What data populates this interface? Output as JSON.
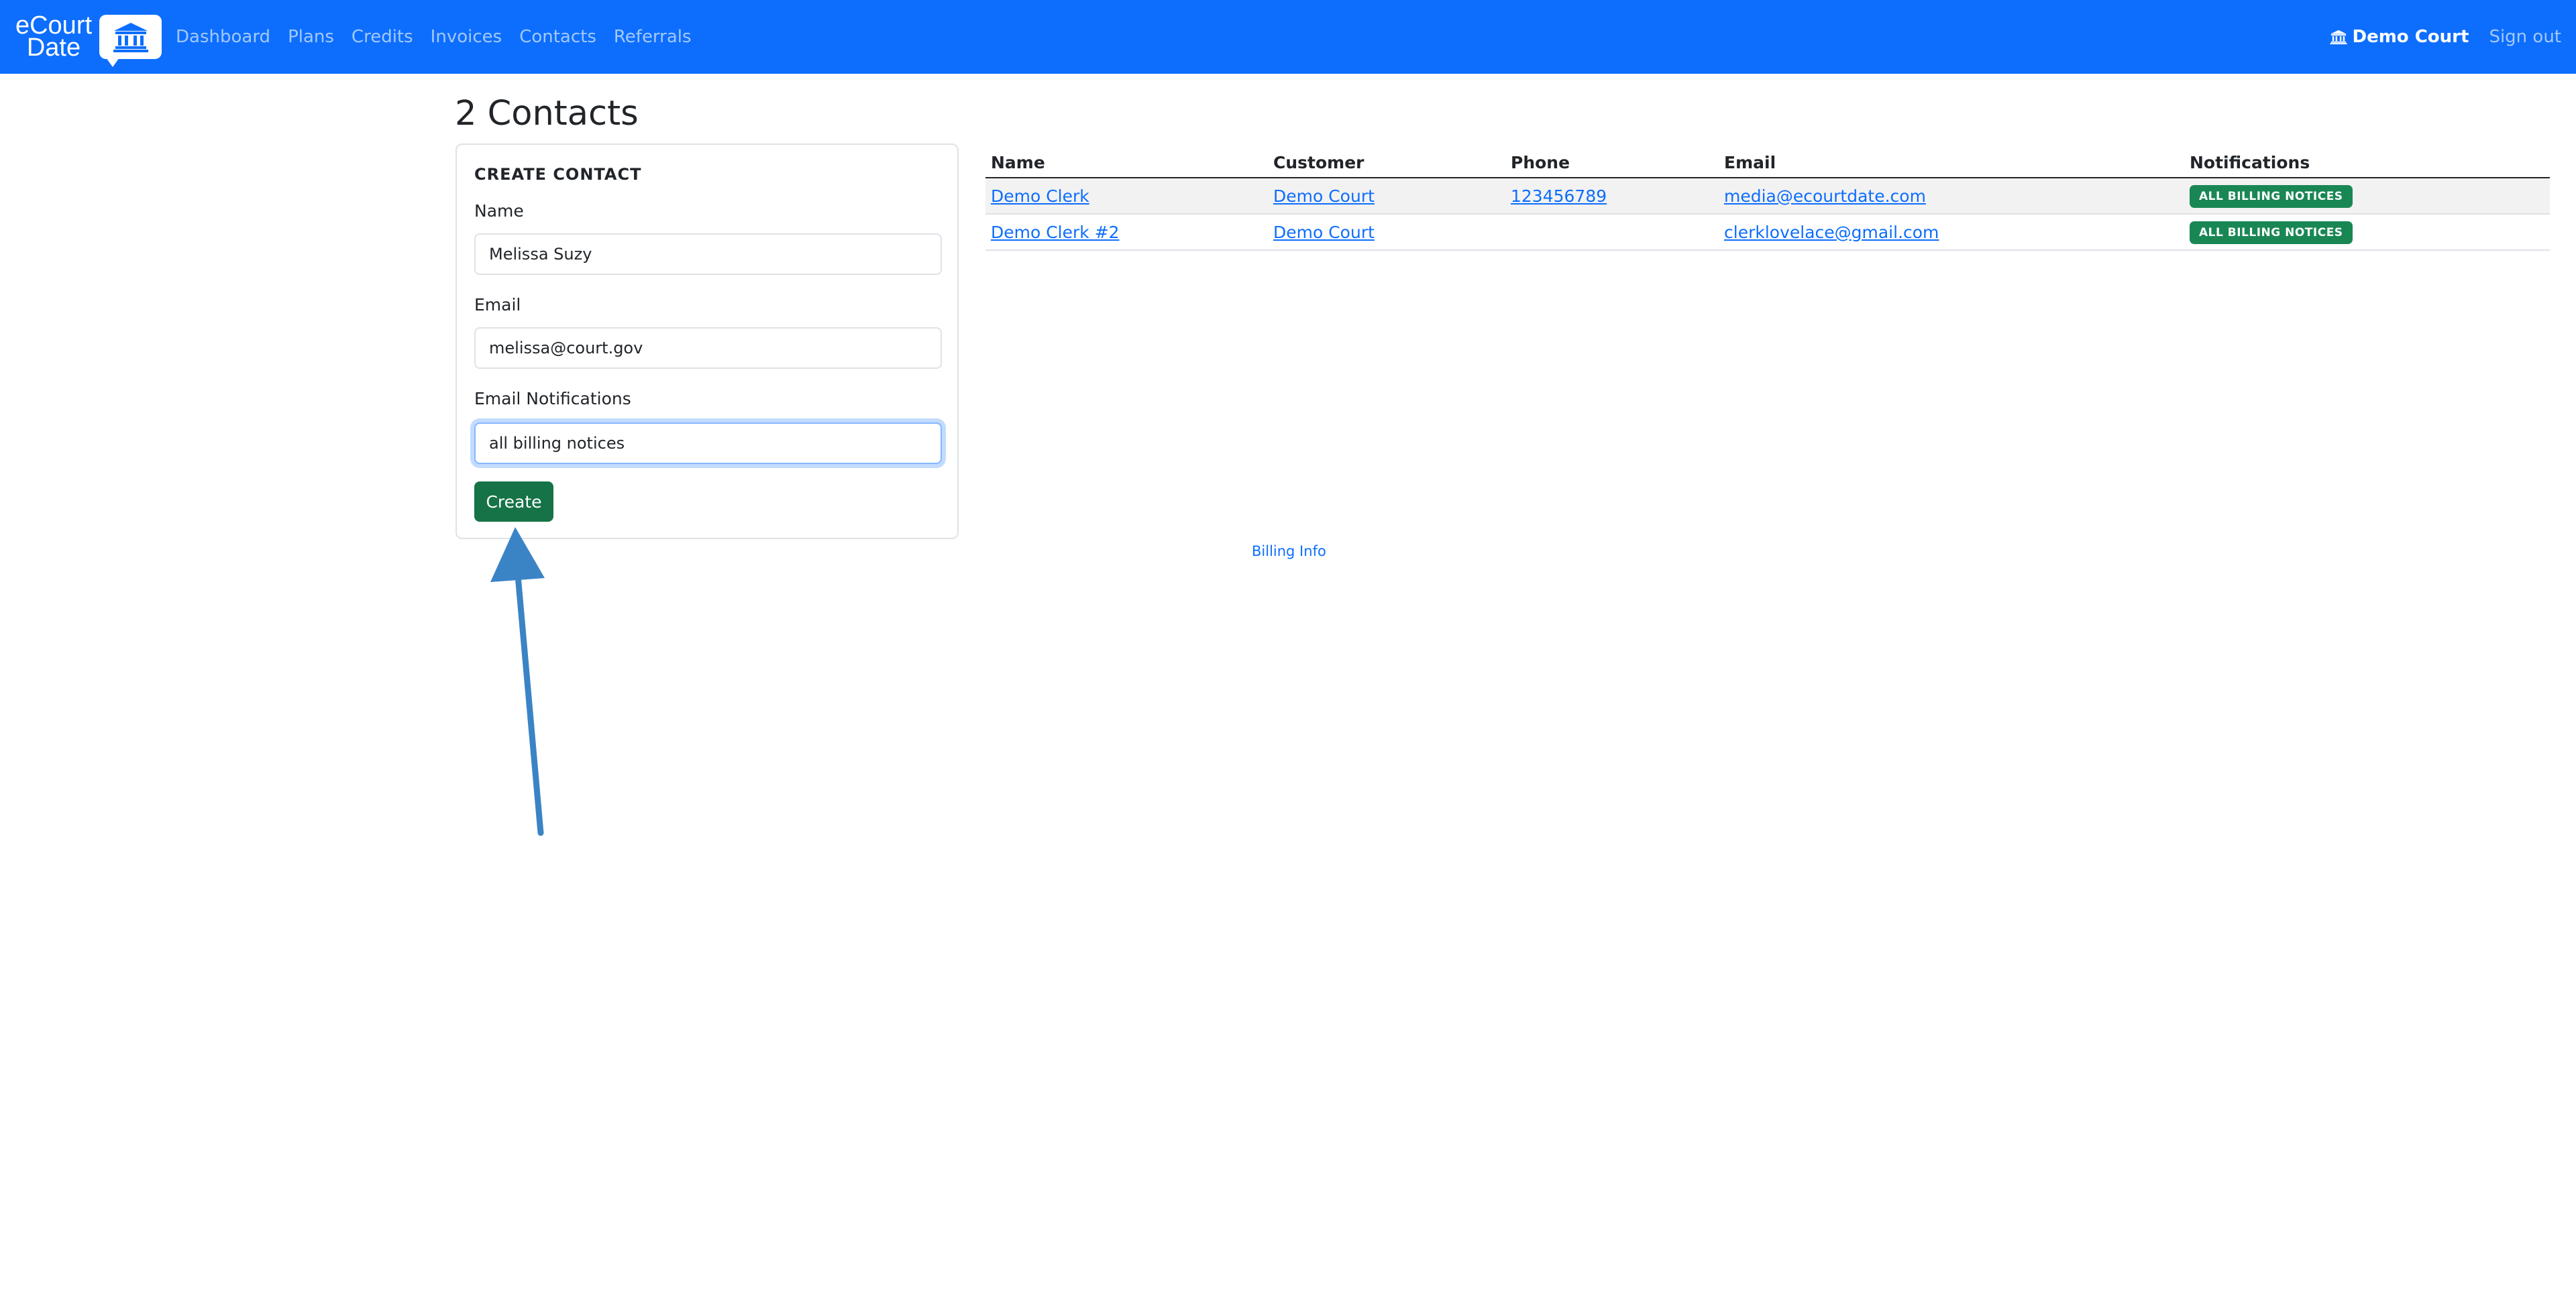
{
  "navbar": {
    "brand_line1": "eCourt",
    "brand_line2": "Date",
    "links": [
      "Dashboard",
      "Plans",
      "Credits",
      "Invoices",
      "Contacts",
      "Referrals"
    ],
    "court_name": "Demo Court",
    "sign_out": "Sign out",
    "brand_color": "#0d6efd"
  },
  "page": {
    "title": "2 Contacts"
  },
  "create_form": {
    "heading": "CREATE CONTACT",
    "name_label": "Name",
    "name_value": "Melissa Suzy",
    "email_label": "Email",
    "email_value": "melissa@court.gov",
    "notifications_label": "Email Notifications",
    "notifications_value": "all billing notices",
    "create_button": "Create"
  },
  "table": {
    "columns": [
      "Name",
      "Customer",
      "Phone",
      "Email",
      "Notifications"
    ],
    "rows": [
      {
        "name": "Demo Clerk",
        "customer": "Demo Court",
        "phone": "123456789",
        "email": "media@ecourtdate.com",
        "notifications": "ALL BILLING NOTICES"
      },
      {
        "name": "Demo Clerk #2",
        "customer": "Demo Court",
        "phone": "",
        "email": "clerklovelace@gmail.com",
        "notifications": "ALL BILLING NOTICES"
      }
    ]
  },
  "footer": {
    "billing_info": "Billing Info"
  },
  "icons": {
    "brand_icon": "courthouse-icon",
    "court_icon": "courthouse-icon",
    "annotation": "arrow-up-annotation"
  }
}
